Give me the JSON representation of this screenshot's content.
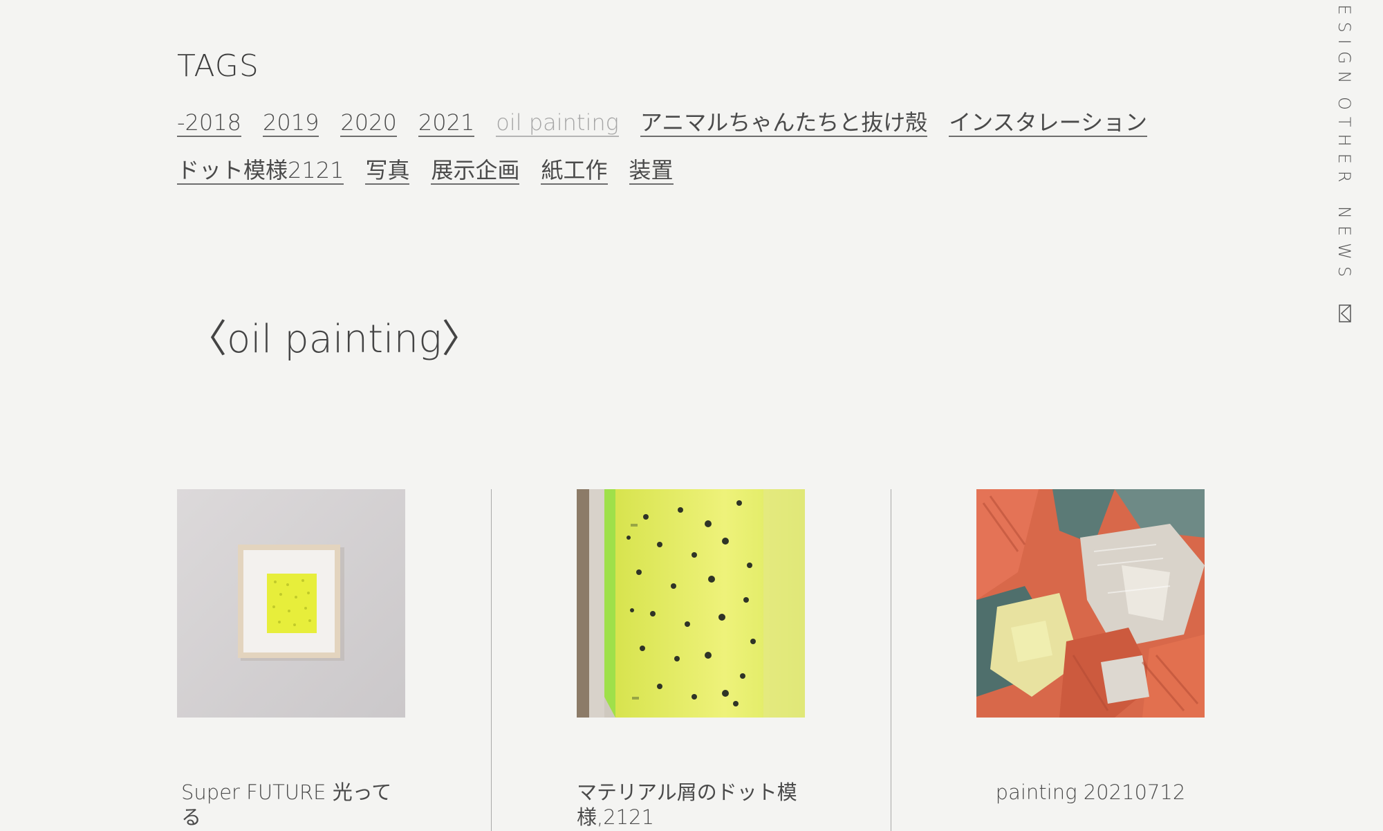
{
  "tags": {
    "title": "TAGS",
    "row1": [
      {
        "label": "-2018",
        "active": false
      },
      {
        "label": "2019",
        "active": false
      },
      {
        "label": "2020",
        "active": false
      },
      {
        "label": "2021",
        "active": false
      },
      {
        "label": "oil painting",
        "active": true
      },
      {
        "label": "アニマルちゃんたちと抜け殻",
        "active": false
      },
      {
        "label": "インスタレーション",
        "active": false
      }
    ],
    "row2": [
      {
        "label": "ドット模様2121",
        "active": false
      },
      {
        "label": "写真",
        "active": false
      },
      {
        "label": "展示企画",
        "active": false
      },
      {
        "label": "紙工作",
        "active": false
      },
      {
        "label": "装置",
        "active": false
      }
    ]
  },
  "section": {
    "title": "〈oil painting〉"
  },
  "works": [
    {
      "title": "Super FUTURE 光ってる"
    },
    {
      "title": "マテリアル屑のドット模様,2121"
    },
    {
      "title": "painting 20210712"
    }
  ],
  "side_nav": {
    "items": [
      "DESIGN",
      "OTHER",
      "NEWS"
    ],
    "contact_icon": "mail-icon"
  },
  "colors": {
    "background": "#f4f4f2",
    "text": "#3e3e3e",
    "active_tag": "#a5a5a5"
  }
}
